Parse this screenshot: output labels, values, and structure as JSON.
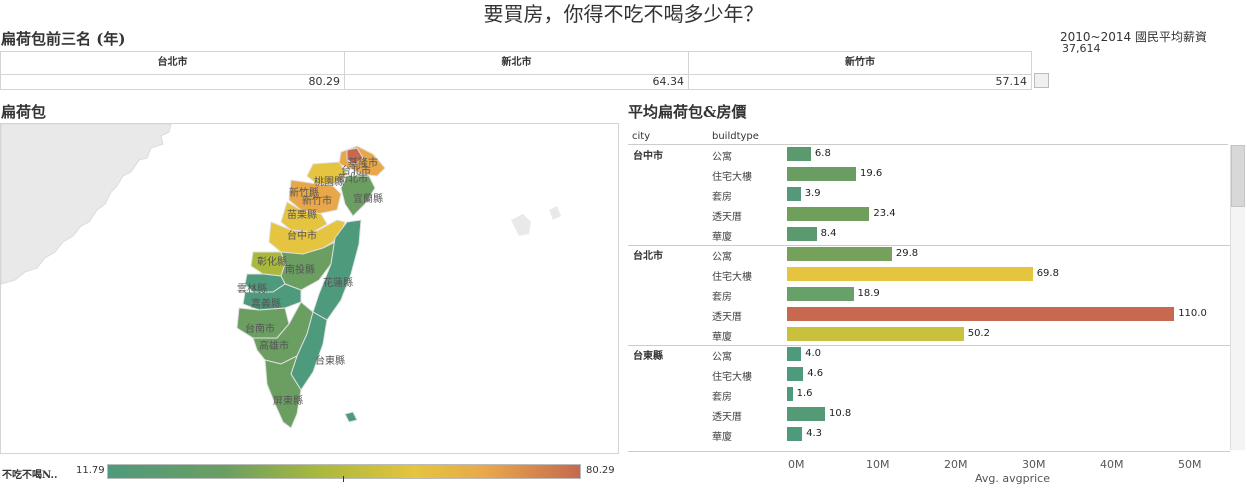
{
  "page_title": "要買房，你得不吃不喝多少年？",
  "salary": {
    "label": "2010~2014 國民平均薪資",
    "value": "37,614"
  },
  "top3": {
    "title": "扁荷包前三名 (年)",
    "columns": [
      {
        "city": "台北市",
        "value": "80.29"
      },
      {
        "city": "新北市",
        "value": "64.34"
      },
      {
        "city": "新竹市",
        "value": "57.14"
      }
    ]
  },
  "map": {
    "title": "扁荷包",
    "labels": [
      "基隆市",
      "台北市",
      "新北市",
      "桃園縣",
      "宜蘭縣",
      "新竹縣",
      "新竹市",
      "苗栗縣",
      "台中市",
      "彰化縣",
      "南投縣",
      "花蓮縣",
      "雲林縣",
      "嘉義縣",
      "台南市",
      "高雄市",
      "台東縣",
      "屏東縣"
    ],
    "colors": {
      "high": "#c6694f",
      "mid_high": "#e8a84a",
      "mid": "#e5c43f",
      "low_mid": "#aab93c",
      "low": "#6b9f62",
      "lowest": "#4e9a7c"
    }
  },
  "legend": {
    "title": "不吃不喝N..",
    "min": "11.79",
    "max": "80.29"
  },
  "chart": {
    "title": "平均扁荷包&房價",
    "head_city": "city",
    "head_buildtype": "buildtype",
    "axis_title": "Avg. avgprice",
    "ticks": [
      "0M",
      "10M",
      "20M",
      "30M",
      "40M",
      "50M"
    ]
  },
  "chart_data": {
    "type": "bar",
    "orientation": "horizontal",
    "xlabel": "Avg. avgprice",
    "xlim": [
      0,
      55000000
    ],
    "ticks": [
      "0M",
      "10M",
      "20M",
      "30M",
      "40M",
      "50M"
    ],
    "color_legend": {
      "title": "不吃不喝N..",
      "min": 11.79,
      "max": 80.29
    },
    "groups": [
      {
        "city": "台中市",
        "rows": [
          {
            "buildtype": "公寓",
            "value": 6.8,
            "label": "6.8",
            "color": "#5b9a6f"
          },
          {
            "buildtype": "住宅大樓",
            "value": 19.6,
            "label": "19.6",
            "color": "#6a9d62"
          },
          {
            "buildtype": "套房",
            "value": 3.9,
            "label": "3.9",
            "color": "#55987a"
          },
          {
            "buildtype": "透天厝",
            "value": 23.4,
            "label": "23.4",
            "color": "#709f5c"
          },
          {
            "buildtype": "華廈",
            "value": 8.4,
            "label": "8.4",
            "color": "#5b9a6f"
          }
        ]
      },
      {
        "city": "台北市",
        "rows": [
          {
            "buildtype": "公寓",
            "value": 29.8,
            "label": "29.8",
            "color": "#76a15b"
          },
          {
            "buildtype": "住宅大樓",
            "value": 69.8,
            "label": "69.8",
            "color": "#e5c43f"
          },
          {
            "buildtype": "套房",
            "value": 18.9,
            "label": "18.9",
            "color": "#67a069"
          },
          {
            "buildtype": "透天厝",
            "value": 110.0,
            "label": "110.0",
            "color": "#c6694f"
          },
          {
            "buildtype": "華廈",
            "value": 50.2,
            "label": "50.2",
            "color": "#c9c03d"
          }
        ]
      },
      {
        "city": "台東縣",
        "rows": [
          {
            "buildtype": "公寓",
            "value": 4.0,
            "label": "4.0",
            "color": "#4e9a7c"
          },
          {
            "buildtype": "住宅大樓",
            "value": 4.6,
            "label": "4.6",
            "color": "#4e9a7c"
          },
          {
            "buildtype": "套房",
            "value": 1.6,
            "label": "1.6",
            "color": "#4e9a7c"
          },
          {
            "buildtype": "透天厝",
            "value": 10.8,
            "label": "10.8",
            "color": "#559a76"
          },
          {
            "buildtype": "華廈",
            "value": 4.3,
            "label": "4.3",
            "color": "#4e9a7c"
          }
        ]
      }
    ]
  }
}
